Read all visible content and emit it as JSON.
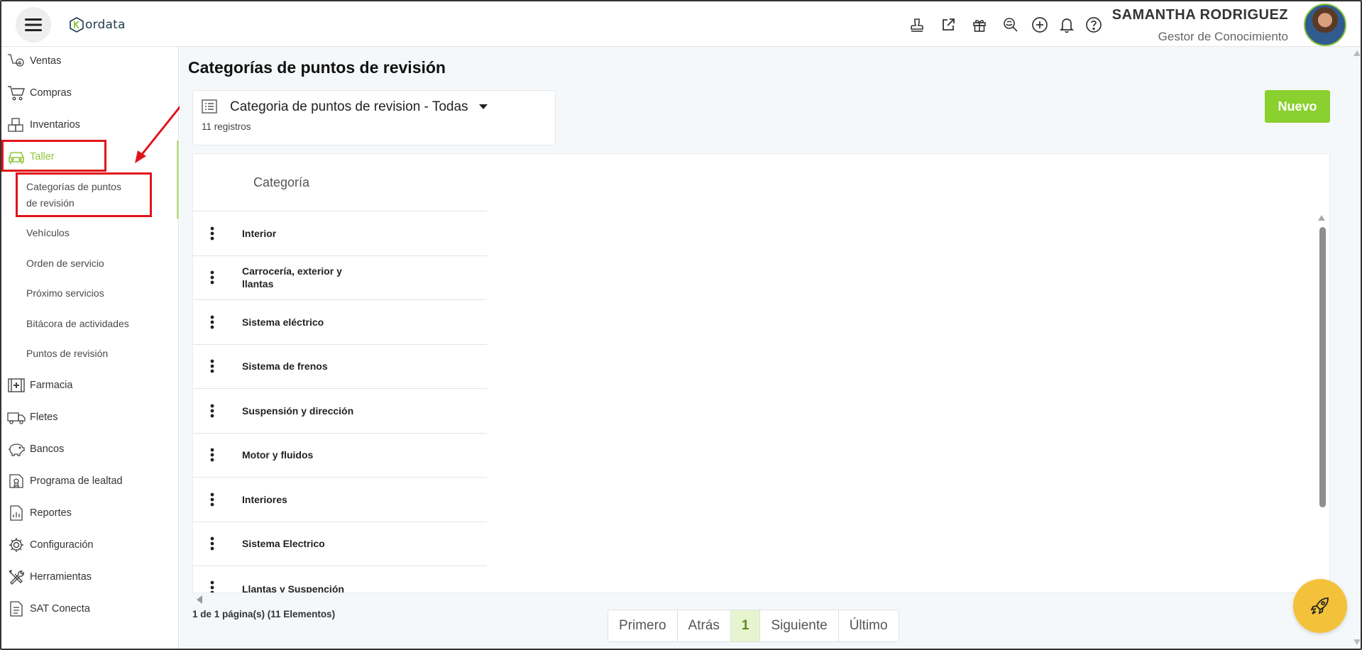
{
  "header": {
    "logo_text": "ordata",
    "user_name": "SAMANTHA RODRIGUEZ",
    "user_role": "Gestor de Conocimiento",
    "icons": [
      "stamp-icon",
      "external-link-icon",
      "gift-icon",
      "search-zoom-icon",
      "plus-circle-icon",
      "bell-icon",
      "help-icon"
    ]
  },
  "sidebar": {
    "items": [
      {
        "label": "Ventas",
        "icon": "sales-icon"
      },
      {
        "label": "Compras",
        "icon": "cart-icon"
      },
      {
        "label": "Inventarios",
        "icon": "boxes-icon"
      },
      {
        "label": "Taller",
        "icon": "car-icon"
      },
      {
        "label": "Farmacia",
        "icon": "pharmacy-icon"
      },
      {
        "label": "Fletes",
        "icon": "truck-icon"
      },
      {
        "label": "Bancos",
        "icon": "piggy-bank-icon"
      },
      {
        "label": "Programa de lealtad",
        "icon": "loyalty-icon"
      },
      {
        "label": "Reportes",
        "icon": "report-icon"
      },
      {
        "label": "Configuración",
        "icon": "gear-icon"
      },
      {
        "label": "Herramientas",
        "icon": "tools-icon"
      },
      {
        "label": "SAT Conecta",
        "icon": "document-icon"
      }
    ],
    "taller_sub": {
      "item0_line1": "Categorías de puntos",
      "item0_line2": "de revisión",
      "item1": "Vehículos",
      "item2": "Orden de servicio",
      "item3": "Próximo servicios",
      "item4": "Bitácora de actividades",
      "item5": "Puntos de revisión"
    }
  },
  "main": {
    "page_title": "Categorías de puntos de revisión",
    "filter_label": "Categoria de puntos de revision - Todas",
    "record_count": "11 registros",
    "new_button": "Nuevo",
    "column_header": "Categoría",
    "rows": [
      "Interior",
      "Carrocería, exterior y llantas",
      "Sistema eléctrico",
      "Sistema de frenos",
      "Suspensión y dirección",
      "Motor y fluidos",
      "Interiores",
      "Sistema Electrico",
      "Llantas y Suspención"
    ],
    "page_info": "1 de 1 página(s) (11 Elementos)",
    "pager": {
      "first": "Primero",
      "prev": "Atrás",
      "current": "1",
      "next": "Siguiente",
      "last": "Último"
    }
  },
  "colors": {
    "accent_green": "#8ad02e",
    "highlight_red": "#e0141b",
    "fab_yellow": "#f4c23a"
  }
}
